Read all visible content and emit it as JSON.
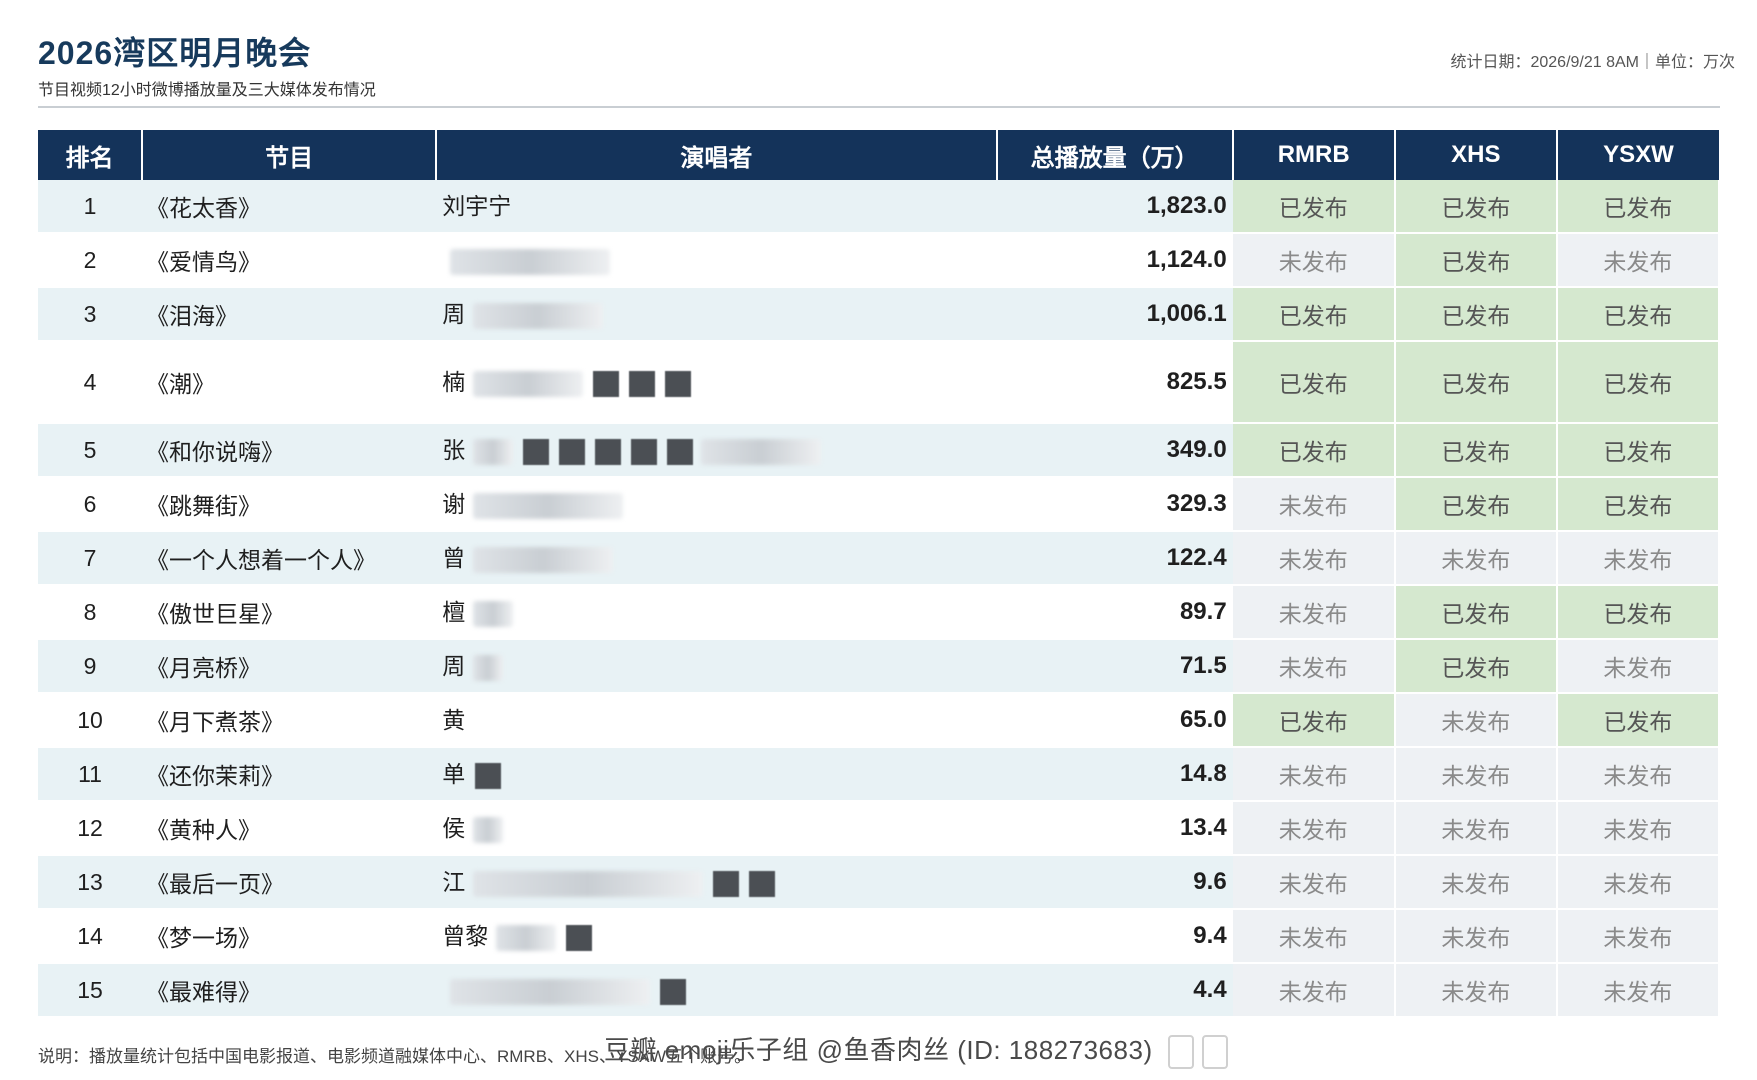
{
  "header": {
    "title": "2026湾区明月晚会",
    "subtitle": "节目视频12小时微博播放量及三大媒体发布情况",
    "meta": "统计日期：2026/9/21 8AM｜单位：万次"
  },
  "table": {
    "columns": [
      "排名",
      "节目",
      "演唱者",
      "总播放量（万）",
      "RMRB",
      "XHS",
      "YSXW"
    ],
    "rows": [
      {
        "rank": "1",
        "program": "《花太香》",
        "singer": "刘宇宁",
        "total": "1,823.0",
        "rmrb": "已发布",
        "xhs": "已发布",
        "ysxw": "已发布"
      },
      {
        "rank": "2",
        "program": "《爱情鸟》",
        "singer": "",
        "total": "1,124.0",
        "rmrb": "未发布",
        "xhs": "已发布",
        "ysxw": "未发布"
      },
      {
        "rank": "3",
        "program": "《泪海》",
        "singer": "周",
        "total": "1,006.1",
        "rmrb": "已发布",
        "xhs": "已发布",
        "ysxw": "已发布"
      },
      {
        "rank": "4",
        "program": "《潮》",
        "singer": "楠",
        "total": "825.5",
        "rmrb": "已发布",
        "xhs": "已发布",
        "ysxw": "已发布"
      },
      {
        "rank": "5",
        "program": "《和你说嗨》",
        "singer": "张",
        "total": "349.0",
        "rmrb": "已发布",
        "xhs": "已发布",
        "ysxw": "已发布"
      },
      {
        "rank": "6",
        "program": "《跳舞街》",
        "singer": "谢",
        "total": "329.3",
        "rmrb": "未发布",
        "xhs": "已发布",
        "ysxw": "已发布"
      },
      {
        "rank": "7",
        "program": "《一个人想着一个人》",
        "singer": "曾",
        "total": "122.4",
        "rmrb": "未发布",
        "xhs": "未发布",
        "ysxw": "未发布"
      },
      {
        "rank": "8",
        "program": "《傲世巨星》",
        "singer": "檀",
        "total": "89.7",
        "rmrb": "未发布",
        "xhs": "已发布",
        "ysxw": "已发布"
      },
      {
        "rank": "9",
        "program": "《月亮桥》",
        "singer": "周",
        "total": "71.5",
        "rmrb": "未发布",
        "xhs": "已发布",
        "ysxw": "未发布"
      },
      {
        "rank": "10",
        "program": "《月下煮茶》",
        "singer": "黄",
        "total": "65.0",
        "rmrb": "已发布",
        "xhs": "未发布",
        "ysxw": "已发布"
      },
      {
        "rank": "11",
        "program": "《还你茉莉》",
        "singer": "单",
        "total": "14.8",
        "rmrb": "未发布",
        "xhs": "未发布",
        "ysxw": "未发布"
      },
      {
        "rank": "12",
        "program": "《黄种人》",
        "singer": "侯",
        "total": "13.4",
        "rmrb": "未发布",
        "xhs": "未发布",
        "ysxw": "未发布"
      },
      {
        "rank": "13",
        "program": "《最后一页》",
        "singer": "江",
        "total": "9.6",
        "rmrb": "未发布",
        "xhs": "未发布",
        "ysxw": "未发布"
      },
      {
        "rank": "14",
        "program": "《梦一场》",
        "singer": "曾黎",
        "total": "9.4",
        "rmrb": "未发布",
        "xhs": "未发布",
        "ysxw": "未发布"
      },
      {
        "rank": "15",
        "program": "《最难得》",
        "singer": "",
        "total": "4.4",
        "rmrb": "未发布",
        "xhs": "未发布",
        "ysxw": "未发布"
      }
    ]
  },
  "footer": {
    "note": "说明：播放量统计包括中国电影报道、电影频道融媒体中心、RMRB、XHS、YSXW五个账号。",
    "watermark": "豆瓣  emoji乐子组 @鱼香肉丝 (ID: 188273683)"
  }
}
